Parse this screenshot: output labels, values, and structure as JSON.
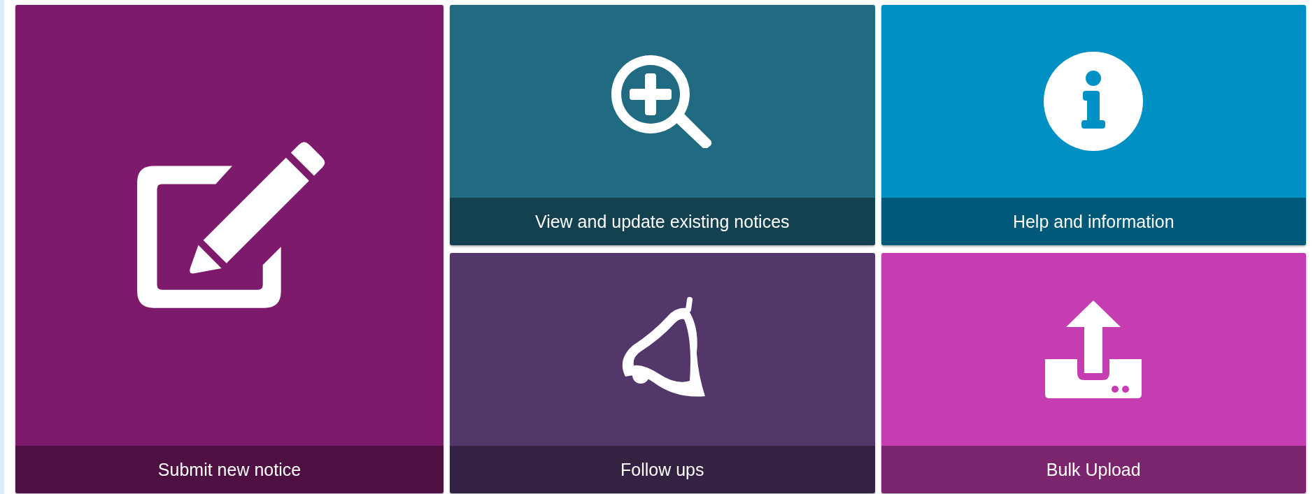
{
  "feature_tile": {
    "label": "Submit new notice",
    "kind": "edit",
    "color": "#7e1a6c"
  },
  "tiles": [
    {
      "label": "View and update existing notices",
      "kind": "search",
      "color": "#206a82"
    },
    {
      "label": "Help and information",
      "kind": "info",
      "color": "#0090c4"
    },
    {
      "label": "Follow ups",
      "kind": "bell",
      "color": "#53376a"
    },
    {
      "label": "Bulk Upload",
      "kind": "upload",
      "color": "#c63db1"
    }
  ]
}
